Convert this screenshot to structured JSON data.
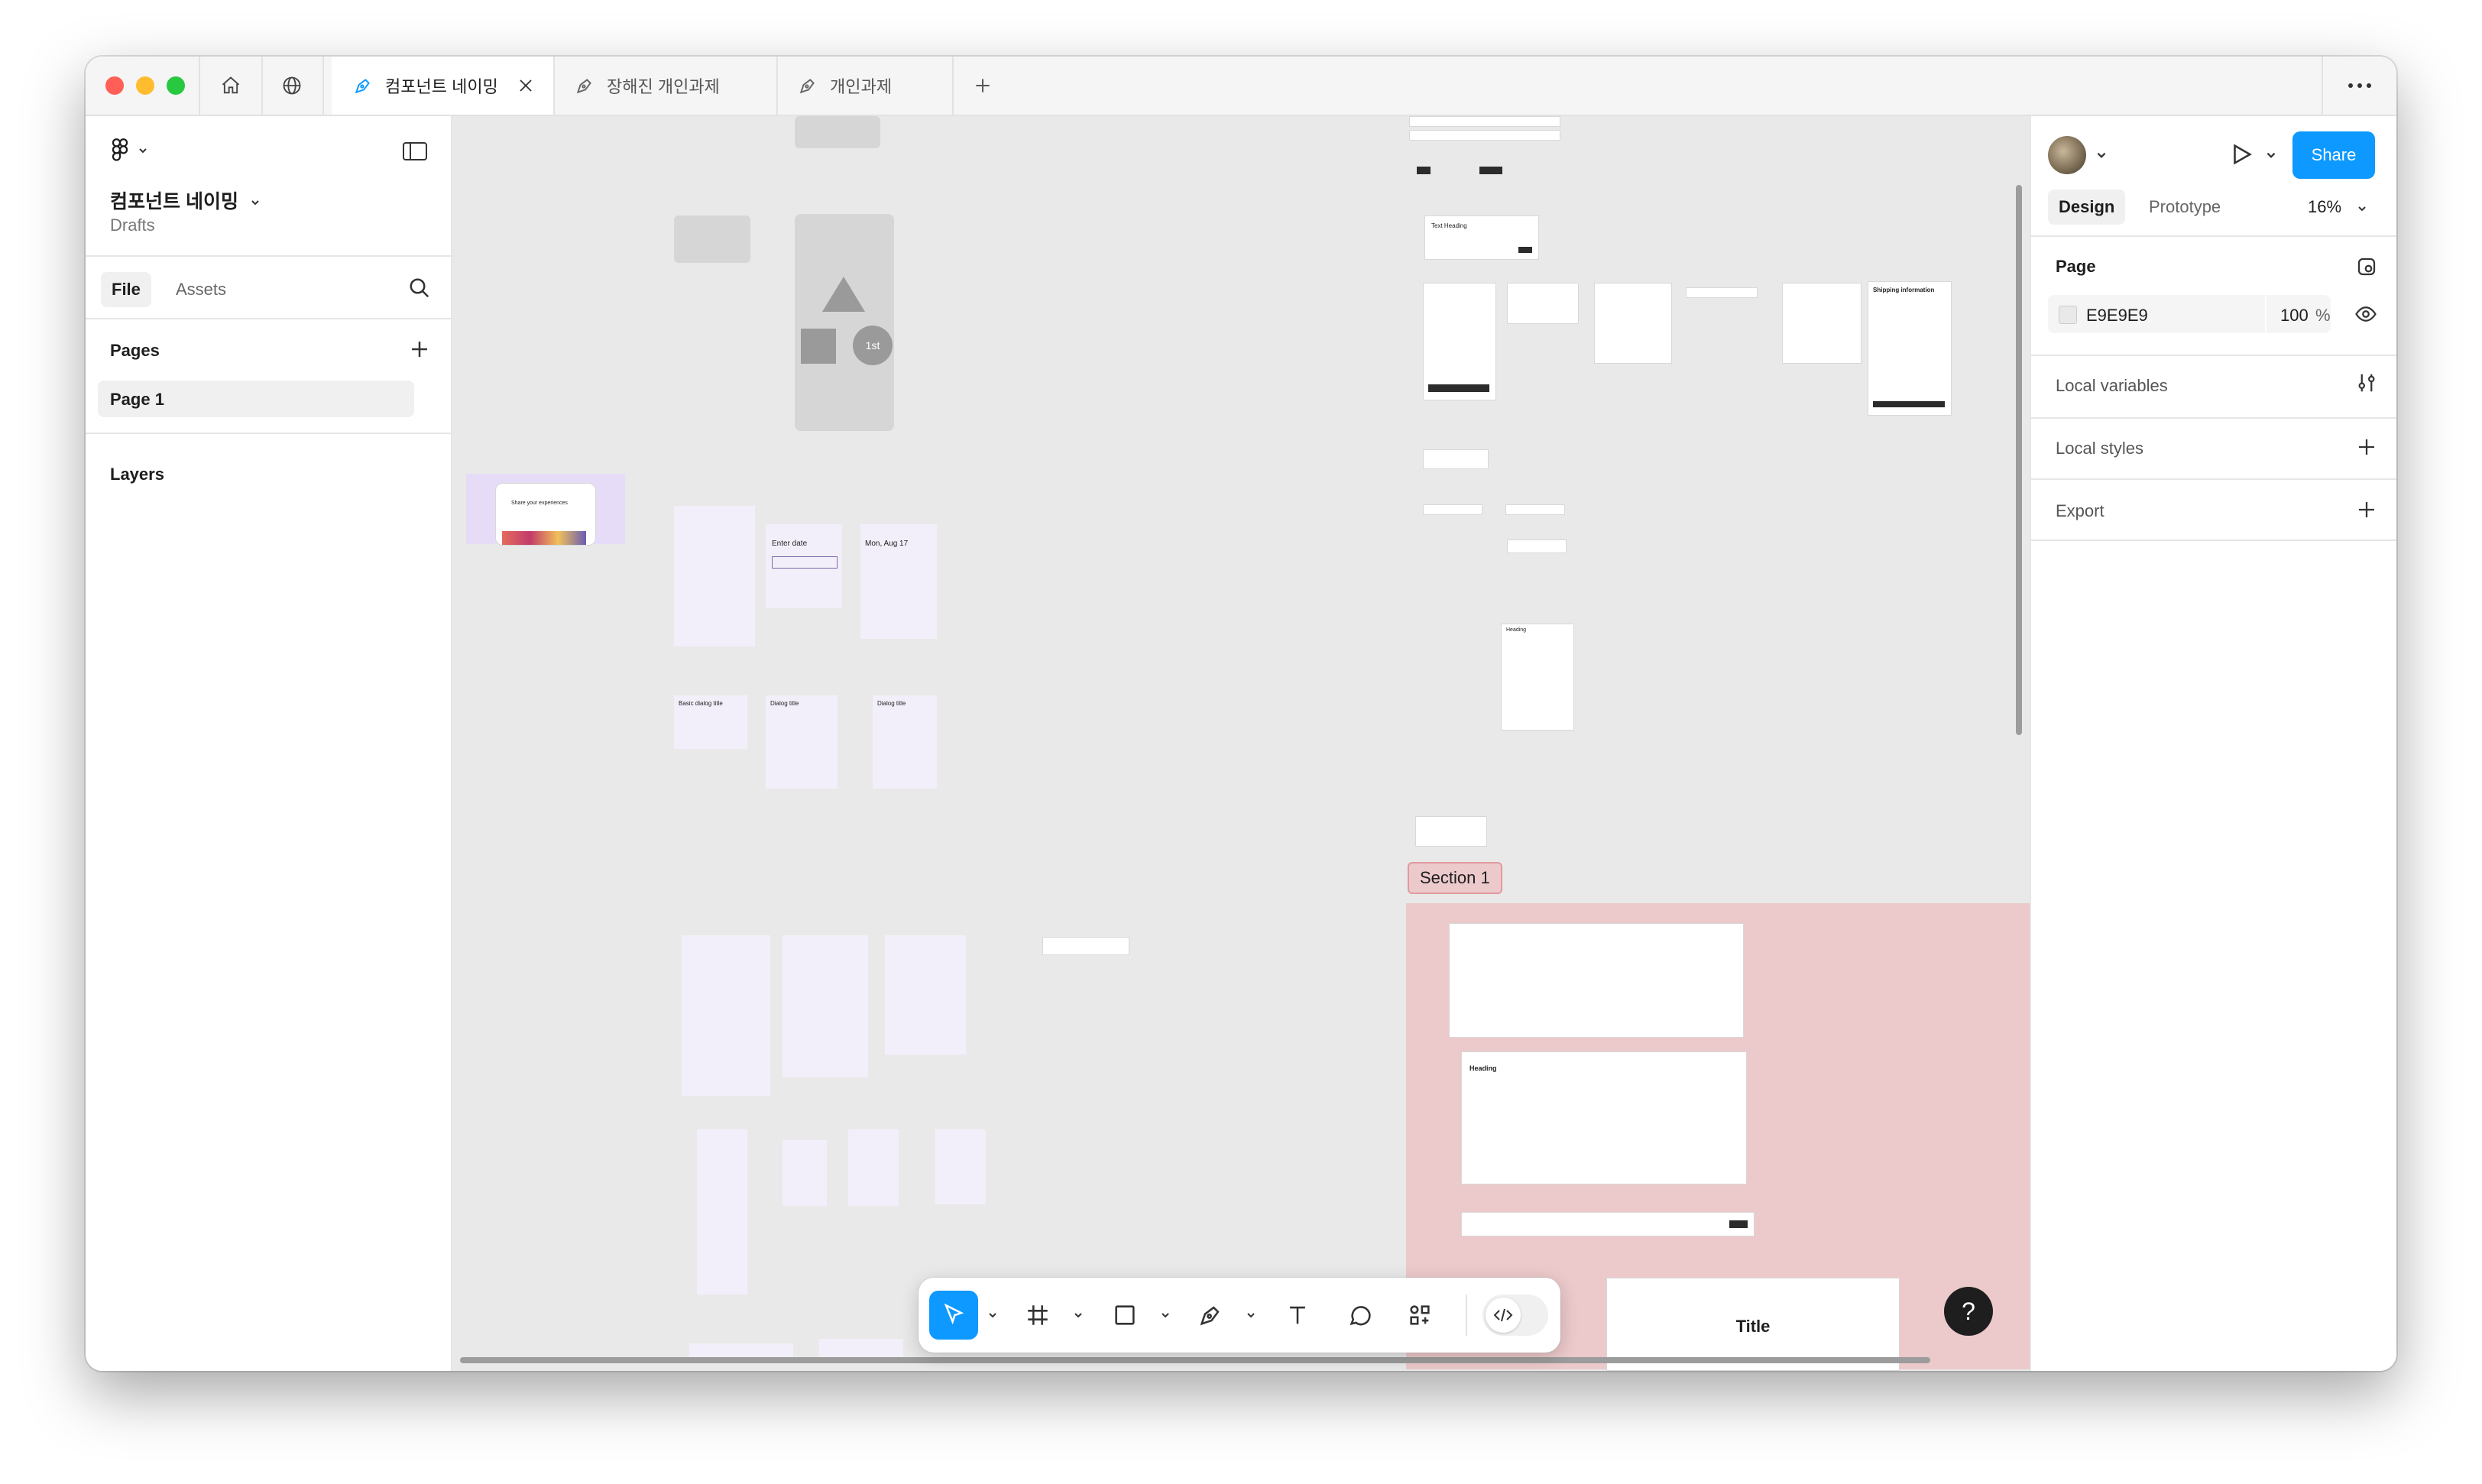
{
  "window": {
    "tabs": [
      {
        "label": "컴포넌트 네이밍",
        "active": true
      },
      {
        "label": "장해진 개인과제",
        "active": false
      },
      {
        "label": "개인과제",
        "active": false
      }
    ]
  },
  "left_panel": {
    "file_name": "컴포넌트 네이밍",
    "location": "Drafts",
    "tab_file": "File",
    "tab_assets": "Assets",
    "pages_heading": "Pages",
    "pages": [
      "Page 1"
    ],
    "layers_heading": "Layers"
  },
  "right_panel": {
    "share_label": "Share",
    "tab_design": "Design",
    "tab_prototype": "Prototype",
    "zoom": "16%",
    "page_heading": "Page",
    "page_color_hex": "E9E9E9",
    "page_opacity": "100",
    "percent_sign": "%",
    "local_variables": "Local variables",
    "local_styles": "Local styles",
    "export": "Export"
  },
  "canvas": {
    "section_label": "Section 1",
    "footer_title": "Title",
    "badge_1st": "1st",
    "mockups": {
      "share_experiences": "Share your experiences",
      "enter_date": "Enter date",
      "date_header": "Mon, Aug 17",
      "basic_dialog_title": "Basic dialog title",
      "dialog_title_1": "Dialog title",
      "dialog_title_2": "Dialog title",
      "text_heading": "Text Heading",
      "shipping_information": "Shipping information",
      "heading": "Heading"
    }
  },
  "toolbar": {
    "tools": [
      "move-tool",
      "frame-tool",
      "shape-tool",
      "pen-tool",
      "text-tool",
      "comment-tool",
      "actions-tool",
      "dev-mode-toggle"
    ]
  },
  "help_label": "?",
  "colors": {
    "accent_blue": "#0d99ff",
    "canvas_bg": "#e9e9e9",
    "section_fill": "#ecc9cb",
    "traffic_red": "#ff5f57",
    "traffic_yellow": "#febc2e",
    "traffic_green": "#28c840"
  }
}
